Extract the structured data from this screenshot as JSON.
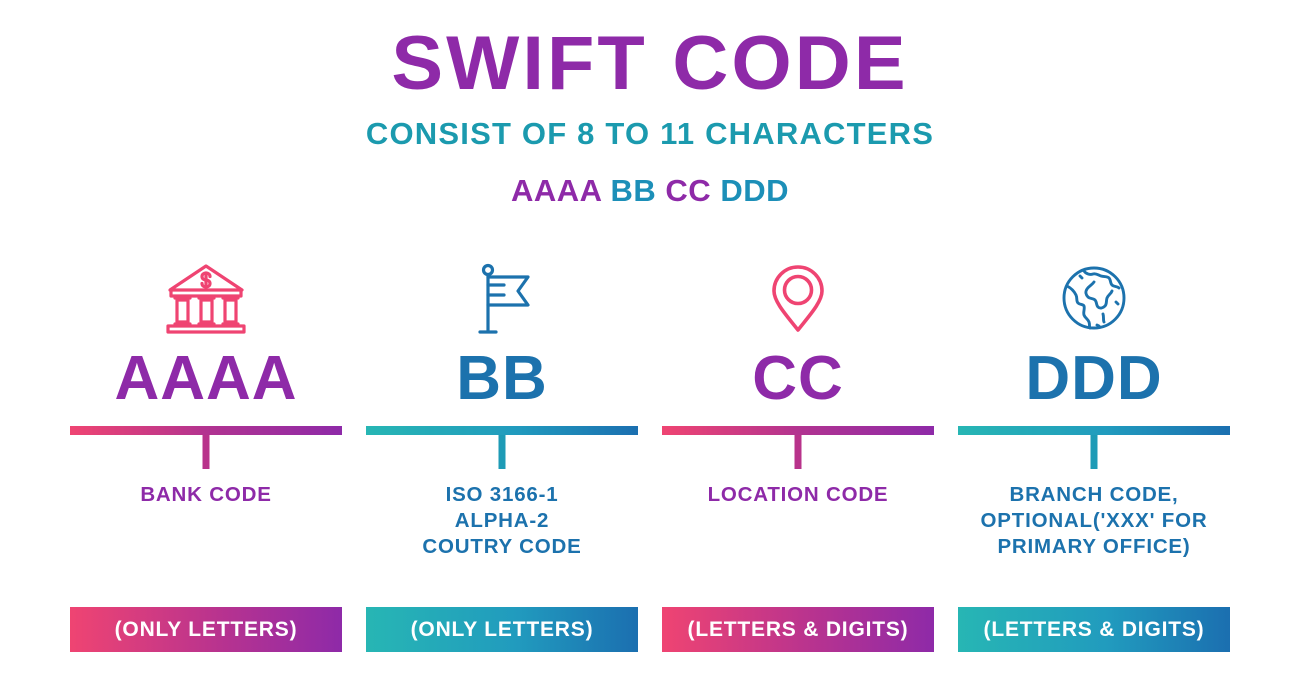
{
  "header": {
    "title": "SWIFT CODE",
    "subtitle": "CONSIST OF 8 TO 11 CHARACTERS",
    "code_segments": [
      {
        "text": "AAAA",
        "color": "#8E2AA8"
      },
      {
        "text": "BB",
        "color": "#1C8FB8"
      },
      {
        "text": "CC",
        "color": "#8E2AA8"
      },
      {
        "text": "DDD",
        "color": "#1C8FB8"
      }
    ],
    "code_full": "AAAABBCCDDD"
  },
  "colors": {
    "purple": "#8E2AA8",
    "pink": "#EF4472",
    "teal": "#27B6B4",
    "blue": "#1C72AD",
    "subtitle_teal": "#1B9AAE",
    "background": "#FFFFFF",
    "badge_text": "#FFFFFF"
  },
  "columns": [
    {
      "icon": "bank-icon",
      "letters": "AAAA",
      "letters_color": "#8E2AA8",
      "label": "BANK CODE",
      "label_color": "#8E2AA8",
      "badge": "(ONLY LETTERS)",
      "bar_theme": "warm"
    },
    {
      "icon": "flag-icon",
      "letters": "BB",
      "letters_color": "#1C72AD",
      "label": "ISO 3166-1\nALPHA-2\nCOUTRY CODE",
      "label_color": "#1C72AD",
      "badge": "(ONLY LETTERS)",
      "bar_theme": "cool"
    },
    {
      "icon": "location-pin-icon",
      "letters": "CC",
      "letters_color": "#8E2AA8",
      "label": "LOCATION CODE",
      "label_color": "#8E2AA8",
      "badge": "(LETTERS & DIGITS)",
      "bar_theme": "warm"
    },
    {
      "icon": "globe-icon",
      "letters": "DDD",
      "letters_color": "#1C72AD",
      "label": "BRANCH CODE,\nOPTIONAL('XXX' FOR\nPRIMARY OFFICE)",
      "label_color": "#1C72AD",
      "badge": "(LETTERS & DIGITS)",
      "bar_theme": "cool"
    }
  ]
}
